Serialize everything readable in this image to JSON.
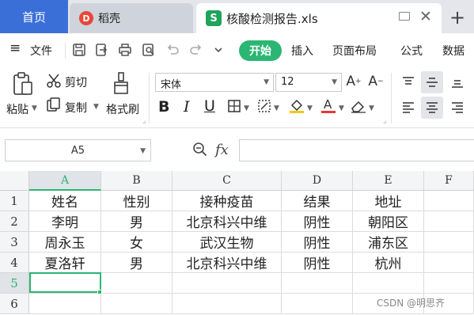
{
  "tabs": {
    "home": "首页",
    "daoke": "稻壳",
    "daoke_logo": "D",
    "doc_logo": "S",
    "doc": "核酸检测报告.xls",
    "close": "✕",
    "new": "+"
  },
  "menu": {
    "hamburger": "≡",
    "file": "文件",
    "start": "开始",
    "insert": "插入",
    "layout": "页面布局",
    "formula": "公式",
    "data": "数据"
  },
  "ribbon": {
    "paste": "粘贴",
    "cut": "剪切",
    "copy": "复制",
    "format_painter": "格式刷",
    "font": "宋体",
    "size": "12",
    "bold": "B",
    "italic": "I",
    "underline": "U"
  },
  "formula_bar": {
    "cell_ref": "A5",
    "fx": "fx",
    "value": ""
  },
  "grid": {
    "columns": [
      "A",
      "B",
      "C",
      "D",
      "E",
      "F"
    ],
    "rows": [
      "1",
      "2",
      "3",
      "4",
      "5",
      "6"
    ],
    "cells": [
      [
        "姓名",
        "性别",
        "接种疫苗",
        "结果",
        "地址",
        ""
      ],
      [
        "李明",
        "男",
        "北京科兴中维",
        "阴性",
        "朝阳区",
        ""
      ],
      [
        "周永玉",
        "女",
        "武汉生物",
        "阴性",
        "浦东区",
        ""
      ],
      [
        "夏洛轩",
        "男",
        "北京科兴中维",
        "阴性",
        "杭州",
        ""
      ],
      [
        "",
        "",
        "",
        "",
        "",
        ""
      ],
      [
        "",
        "",
        "",
        "",
        "",
        ""
      ]
    ],
    "selected_cell": "A5"
  },
  "watermark": "CSDN @明思齐",
  "colors": {
    "accent_green": "#2bb673",
    "home_tab_blue": "#3b6fd8",
    "daoke_red": "#e8473b"
  }
}
